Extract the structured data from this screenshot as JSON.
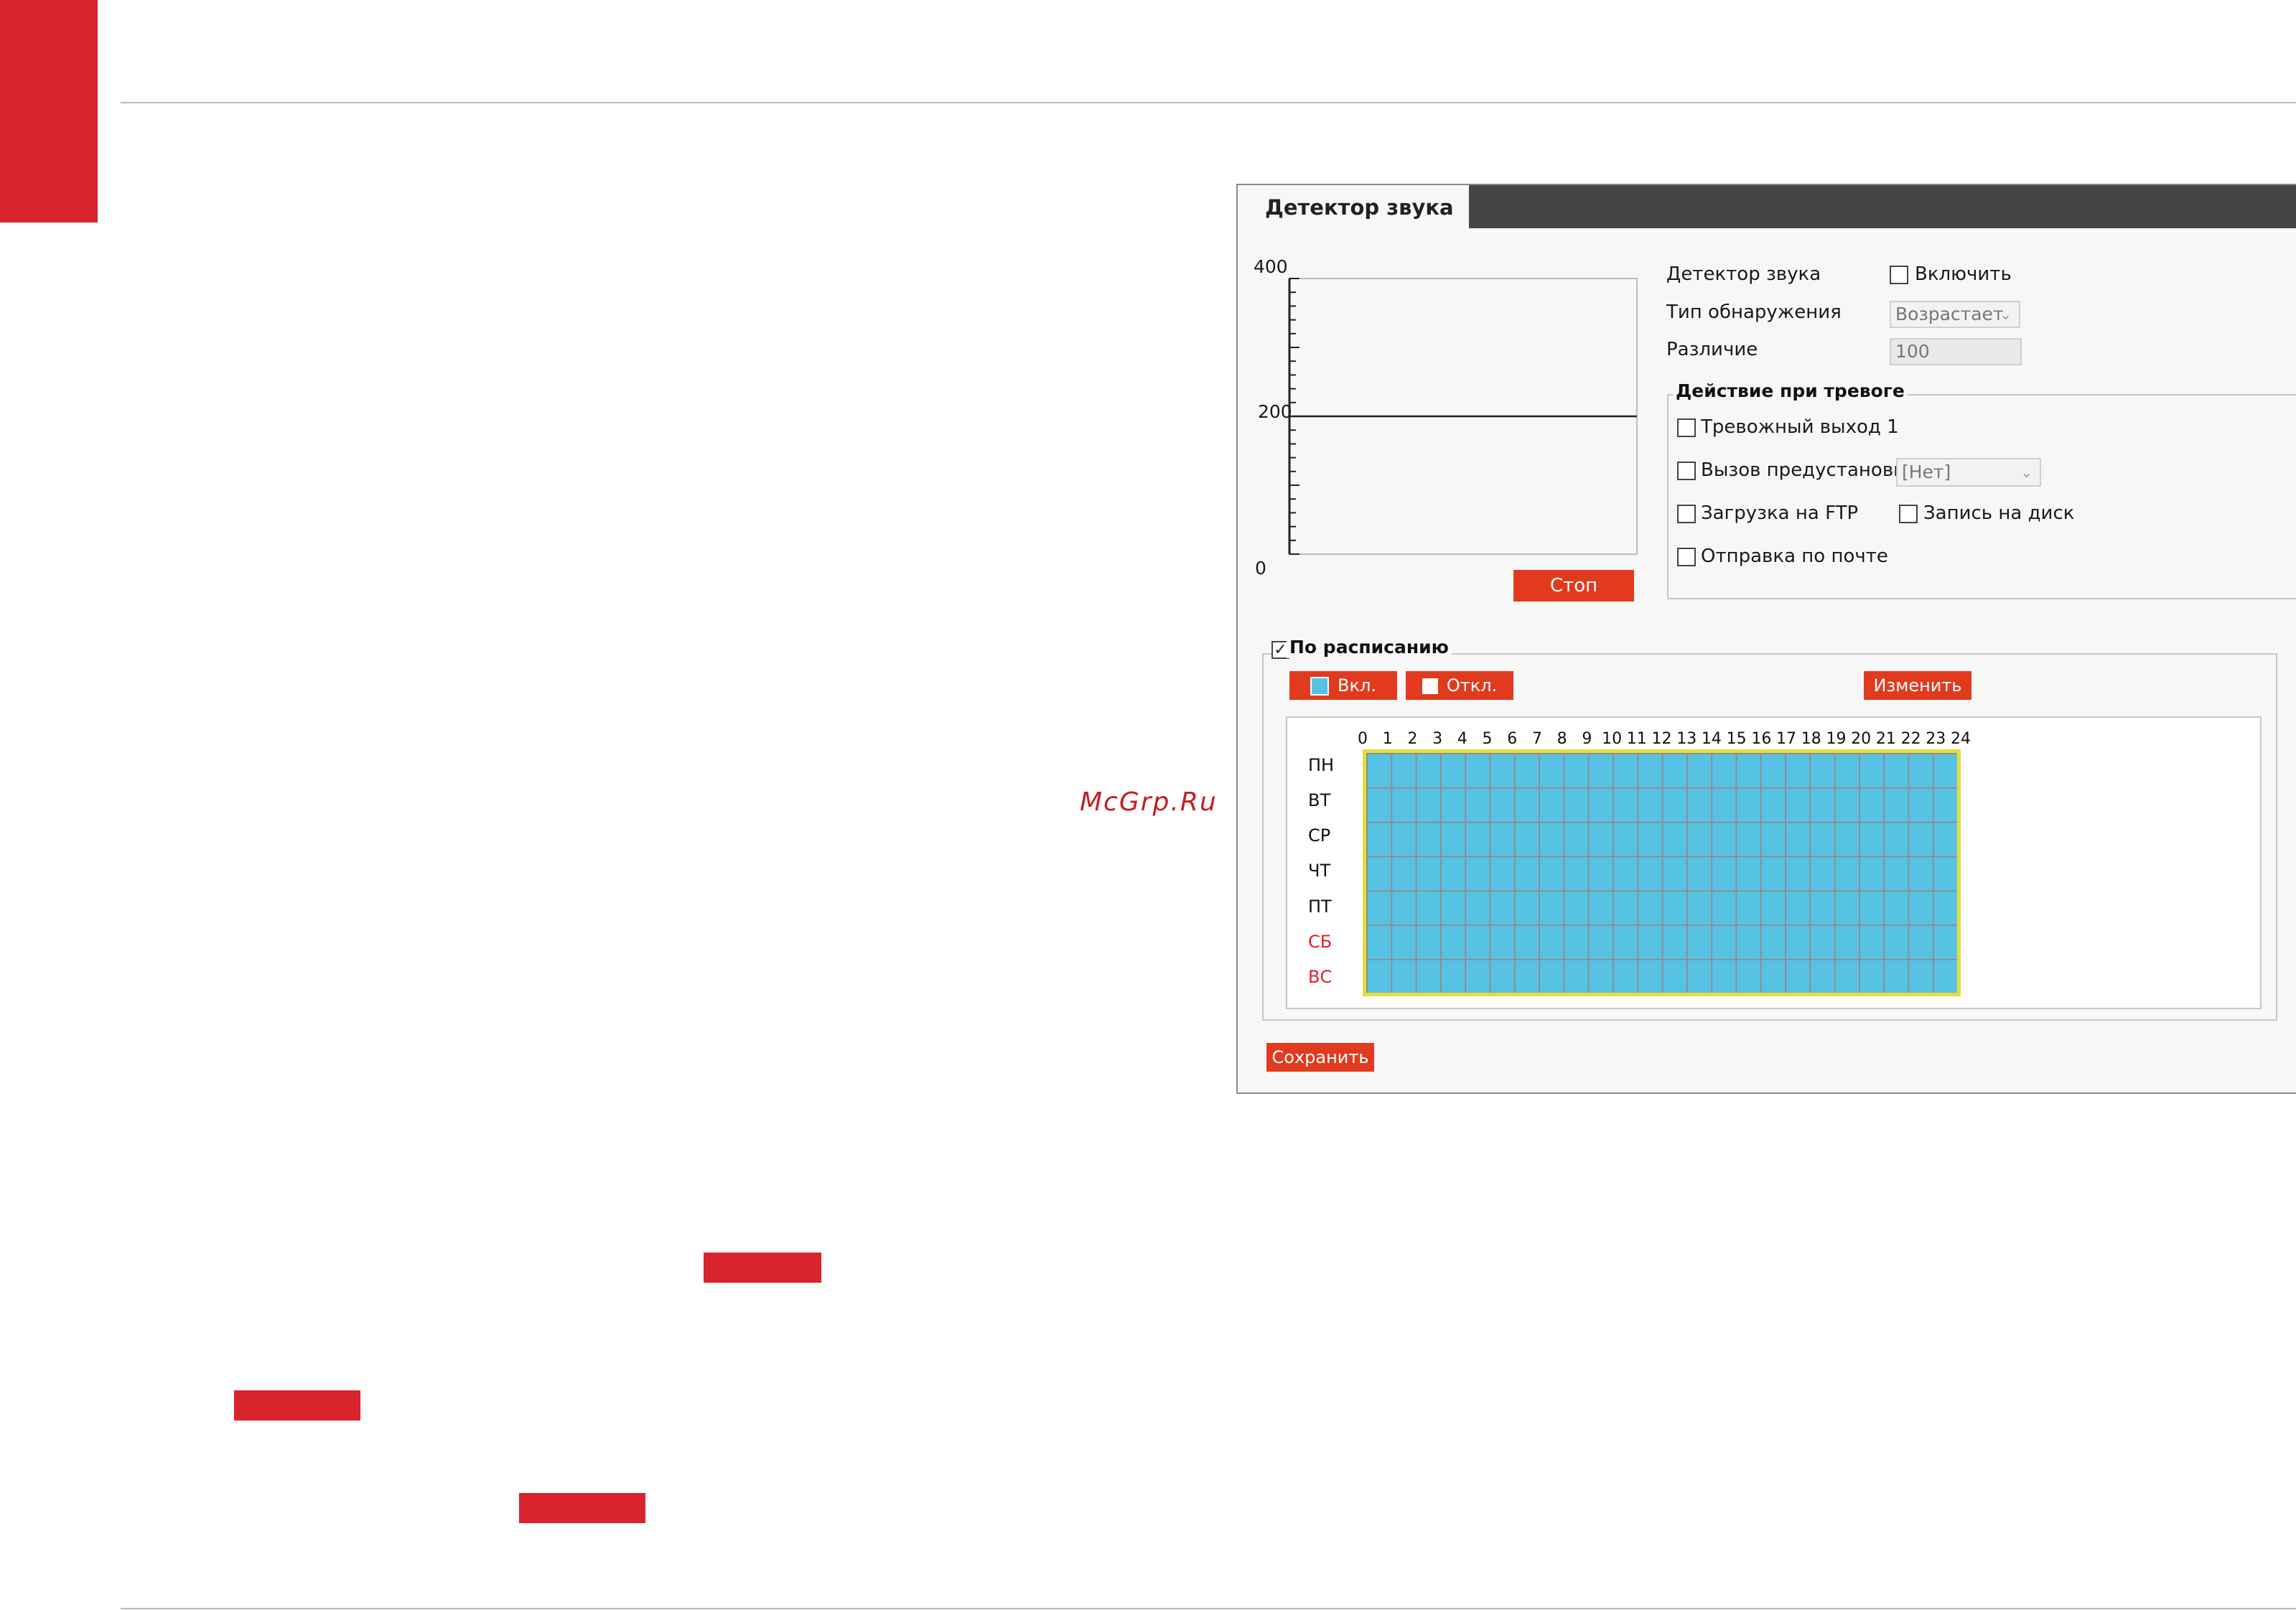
{
  "watermark": "McGrp.Ru",
  "tab": {
    "label": "Детектор звука"
  },
  "level_chart": {
    "y_ticks": [
      "400",
      "200",
      "0"
    ],
    "ylim": [
      0,
      400
    ],
    "threshold": 200,
    "stop_label": "Стоп"
  },
  "settings": {
    "detector_label": "Детектор звука",
    "enable_label": "Включить",
    "enable_checked": false,
    "type_label": "Тип обнаружения",
    "type_value": "Возрастает",
    "diff_label": "Различие",
    "diff_value": "100"
  },
  "alarm": {
    "title": "Действие при тревоге",
    "output_label": "Тревожный выход 1",
    "preset_label": "Вызов предустановки",
    "preset_value": "[Нет]",
    "ftp_label": "Загрузка на FTP",
    "disk_label": "Запись на диск",
    "mail_label": "Отправка по почте"
  },
  "schedule": {
    "title": "По расписанию",
    "checked": true,
    "on_label": "Вкл.",
    "off_label": "Откл.",
    "edit_label": "Изменить",
    "hours": [
      "0",
      "1",
      "2",
      "3",
      "4",
      "5",
      "6",
      "7",
      "8",
      "9",
      "10",
      "11",
      "12",
      "13",
      "14",
      "15",
      "16",
      "17",
      "18",
      "19",
      "20",
      "21",
      "22",
      "23",
      "24"
    ],
    "days": [
      "ПН",
      "ВТ",
      "СР",
      "ЧТ",
      "ПТ",
      "СБ",
      "ВС"
    ],
    "weekend_color": "#e0202a",
    "cell_color": "#56c3e5"
  },
  "save_label": "Сохранить"
}
